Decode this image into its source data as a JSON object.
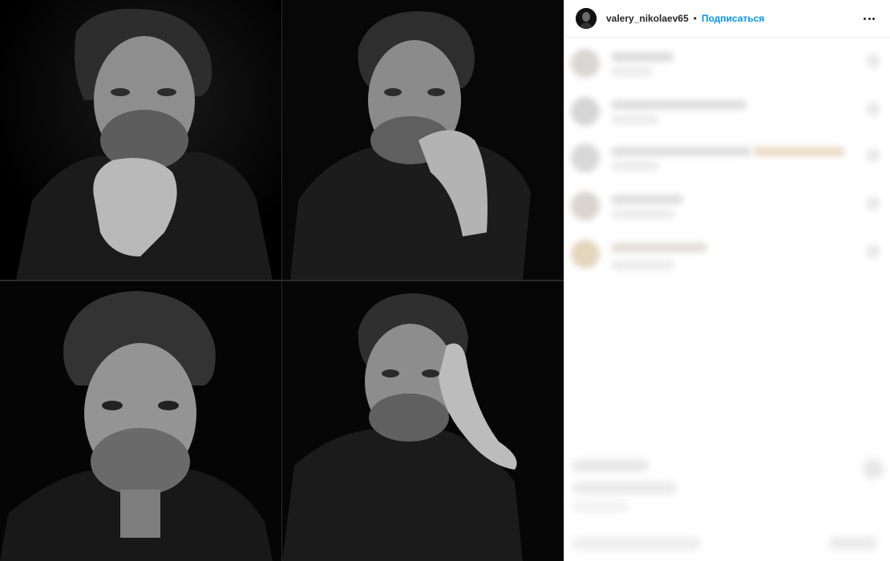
{
  "post": {
    "header": {
      "username": "valery_nikolaev65",
      "separator": "•",
      "follow_label": "Подписаться",
      "more_icon": "more-horizontal-icon"
    },
    "media": {
      "type": "photo-collage",
      "tiles": 4
    }
  }
}
